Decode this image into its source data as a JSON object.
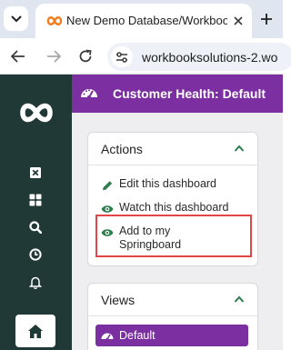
{
  "browser": {
    "tab": {
      "title": "New Demo Database/Workbooks"
    },
    "toolbar": {
      "url": "workbooksolutions-2.wo"
    }
  },
  "app": {
    "header": {
      "title": "Customer Health: Default"
    },
    "actions_panel": {
      "title": "Actions",
      "items": [
        {
          "label": "Edit this dashboard",
          "icon": "pencil-icon"
        },
        {
          "label": "Watch this dashboard",
          "icon": "eye-icon"
        },
        {
          "label": "Add to my Springboard",
          "icon": "eye-icon"
        }
      ]
    },
    "views_panel": {
      "title": "Views",
      "items": [
        {
          "label": "Default",
          "icon": "dashboard-gauge-icon"
        }
      ]
    }
  },
  "colors": {
    "brand_purple": "#7c2fa0",
    "sidebar_dark_green": "#213936",
    "action_icon_green": "#2e7d4f",
    "highlight_red": "#e24545"
  }
}
